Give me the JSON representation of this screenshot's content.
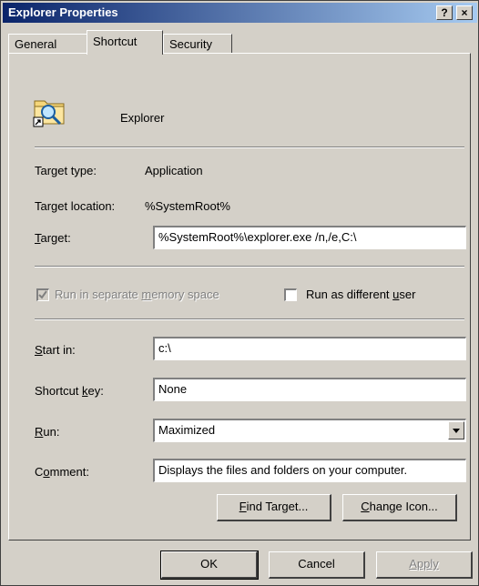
{
  "window": {
    "title": "Explorer Properties",
    "help_button": "?",
    "close_button": "×"
  },
  "tabs": [
    {
      "label": "General",
      "active": false
    },
    {
      "label": "Shortcut",
      "active": true
    },
    {
      "label": "Security",
      "active": false
    }
  ],
  "shortcut": {
    "name": "Explorer",
    "target_type_label": "Target type:",
    "target_type_value": "Application",
    "target_location_label": "Target location:",
    "target_location_value": "%SystemRoot%",
    "target_label_first": "T",
    "target_label_rest": "arget:",
    "target_value": "%SystemRoot%\\explorer.exe  /n,/e,C:\\",
    "run_separate_label_a": "Run in sepa",
    "run_separate_label_b": "rate ",
    "run_separate_label_u": "m",
    "run_separate_label_c": "emory space",
    "run_separate_checked": true,
    "run_as_user_label_a": "Run as different ",
    "run_as_user_label_u": "u",
    "run_as_user_label_b": "ser",
    "run_as_user_checked": false,
    "start_in_label_u": "S",
    "start_in_label_rest": "tart in:",
    "start_in_value": "c:\\",
    "shortcut_key_label_a": "Shortcut ",
    "shortcut_key_label_u": "k",
    "shortcut_key_label_b": "ey:",
    "shortcut_key_value": "None",
    "run_label_u": "R",
    "run_label_rest": "un:",
    "run_value": "Maximized",
    "comment_label_a": "C",
    "comment_label_u": "o",
    "comment_label_b": "mment:",
    "comment_value": "Displays the files and folders on your computer.",
    "find_target_u": "F",
    "find_target_rest": "ind Target...",
    "change_icon_u": "C",
    "change_icon_rest": "hange Icon..."
  },
  "footer": {
    "ok_label": "OK",
    "cancel_label": "Cancel",
    "apply_label": "Apply"
  }
}
